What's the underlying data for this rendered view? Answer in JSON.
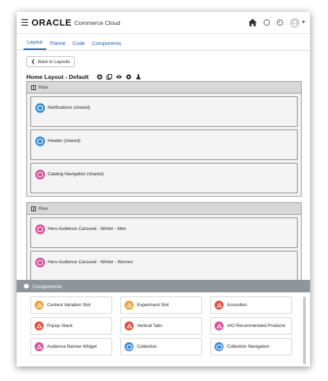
{
  "app": {
    "brand": "ORACLE",
    "product": "Commerce Cloud"
  },
  "tabs": [
    {
      "label": "Layout",
      "active": true
    },
    {
      "label": "Theme",
      "active": false
    },
    {
      "label": "Code",
      "active": false
    },
    {
      "label": "Components",
      "active": false
    }
  ],
  "back_button": {
    "label": "Back to Layouts"
  },
  "page_title": "Home Layout - Default",
  "rows": [
    {
      "label": "Row",
      "widgets": [
        {
          "label": "Notifications (shared)",
          "color": "#3d8fd4",
          "icon": "cube-icon"
        },
        {
          "label": "Header (shared)",
          "color": "#3d8fd4",
          "icon": "cube-icon"
        },
        {
          "label": "Catalog Navigation (shared)",
          "color": "#d9519b",
          "icon": "cube-icon"
        }
      ]
    },
    {
      "label": "Row",
      "widgets": [
        {
          "label": "Hero Audience Carousel - Winter - Men",
          "color": "#d9519b",
          "icon": "cube-icon"
        },
        {
          "label": "Hero Audience Carousel - Winter - Women",
          "color": "#d9519b",
          "icon": "cube-icon"
        }
      ]
    }
  ],
  "components_panel": {
    "title": "Components",
    "items": [
      {
        "label": "Content Variation Slot",
        "color": "#f0a23c"
      },
      {
        "label": "Experiment Slot",
        "color": "#f0a23c"
      },
      {
        "label": "Accordion",
        "color": "#e0503e"
      },
      {
        "label": "Popup Stack",
        "color": "#e0503e"
      },
      {
        "label": "Vertical Tabs",
        "color": "#e0503e"
      },
      {
        "label": "AIO Recommended Products",
        "color": "#d9519b"
      },
      {
        "label": "Audience Banner Widget",
        "color": "#d9519b"
      },
      {
        "label": "Collection",
        "color": "#3d8fd4"
      },
      {
        "label": "Collection Navigation",
        "color": "#3d8fd4"
      }
    ]
  },
  "colors": {
    "accent": "#1a5fa6",
    "panel_header": "#8e959b"
  }
}
